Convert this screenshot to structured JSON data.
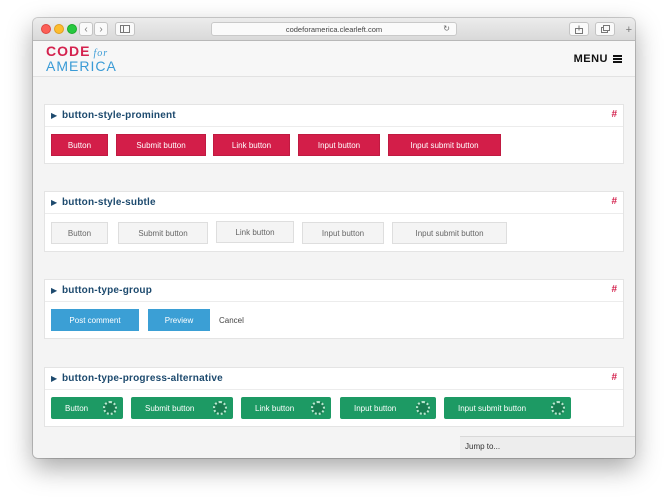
{
  "browser": {
    "url": "codeforamerica.clearleft.com"
  },
  "header": {
    "logo_code": "CODE",
    "logo_for": "for",
    "logo_america": "AMERICA",
    "menu_label": "MENU"
  },
  "sections": [
    {
      "title": "button-style-prominent",
      "hash": "#",
      "buttons": [
        "Button",
        "Submit button",
        "Link button",
        "Input button",
        "Input submit button"
      ]
    },
    {
      "title": "button-style-subtle",
      "hash": "#",
      "buttons": [
        "Button",
        "Submit button",
        "Link button",
        "Input button",
        "Input submit button"
      ]
    },
    {
      "title": "button-type-group",
      "hash": "#",
      "buttons": [
        "Post comment",
        "Preview"
      ],
      "cancel": "Cancel"
    },
    {
      "title": "button-type-progress-alternative",
      "hash": "#",
      "buttons": [
        "Button",
        "Submit button",
        "Link button",
        "Input button",
        "Input submit button"
      ]
    }
  ],
  "jump_to": "Jump to...",
  "colors": {
    "prominent": "#d31e49",
    "link_blue": "#1d4a6e",
    "group_blue": "#3b9fd5",
    "progress_green": "#1d9a64"
  }
}
